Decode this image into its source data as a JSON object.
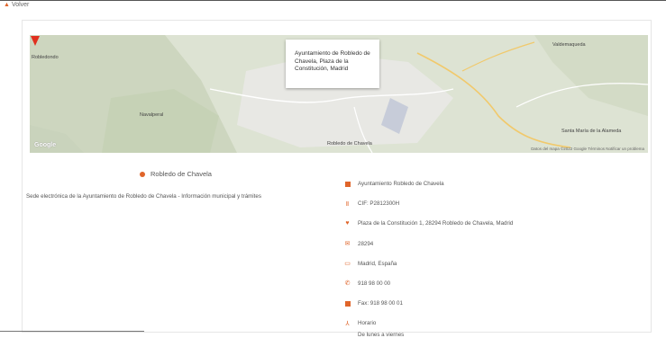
{
  "nav": {
    "back_label": "Volver"
  },
  "map": {
    "popup_text": "Ayuntamiento de Robledo de Chavela, Plaza de la Constitución, Madrid",
    "labels": [
      "Robledondo",
      "Navalperal",
      "Valdemaqueda",
      "Robledo de Chavela",
      "Santa María de la Alameda"
    ],
    "logo": "Google",
    "attribution": "Datos del mapa ©2022 Google  Términos  Notificar un problema"
  },
  "info": {
    "heading": "Robledo de Chavela",
    "description": "Sede electrónica de la Ayuntamiento de Robledo de Chavela - Información municipal y trámites",
    "items": [
      {
        "icon": "building-icon",
        "text": "Ayuntamiento Robledo de Chavela"
      },
      {
        "icon": "id-card-icon",
        "text": "CIF: P2812300H"
      },
      {
        "icon": "map-pin-icon",
        "text": "Plaza de la Constitución 1, 28294 Robledo de Chavela, Madrid"
      },
      {
        "icon": "mail-icon",
        "text": "28294"
      },
      {
        "icon": "globe-icon",
        "text": "Madrid, España"
      },
      {
        "icon": "phone-icon",
        "text": "918 98 00 00"
      },
      {
        "icon": "fax-icon",
        "text": "Fax: 918 98 00 01"
      },
      {
        "icon": "person-icon",
        "text": "Horario",
        "sub": "De lunes a viernes"
      }
    ]
  }
}
